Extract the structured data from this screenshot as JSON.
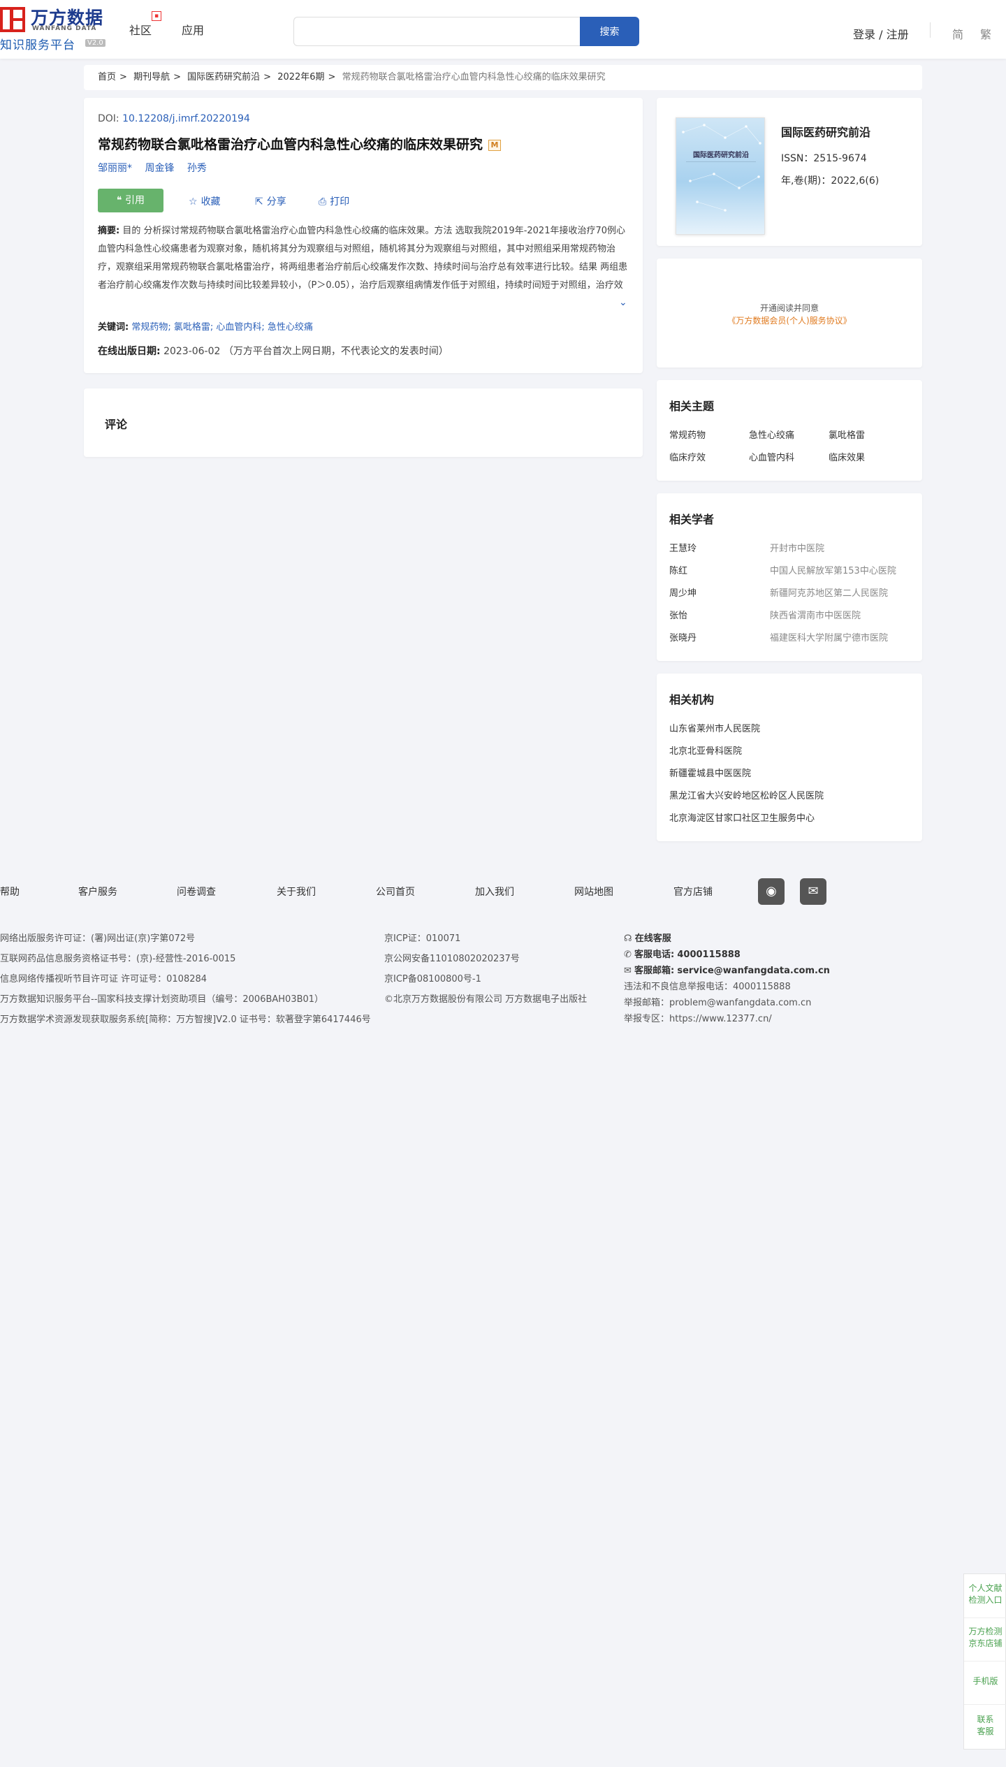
{
  "header": {
    "logo_cn": "万方数据",
    "logo_en": "WANFANG DATA",
    "platform": "知识服务平台",
    "version": "V2.0",
    "nav": [
      "社区",
      "应用"
    ],
    "search_placeholder": "",
    "search_button": "搜索",
    "login": "登录 / 注册",
    "lang_simplified": "简",
    "lang_traditional": "繁"
  },
  "breadcrumb": {
    "items": [
      "首页",
      "期刊导航",
      "国际医药研究前沿",
      "2022年6期"
    ],
    "current": "常规药物联合氯吡格雷治疗心血管内科急性心绞痛的临床效果研究"
  },
  "article": {
    "doi_label": "DOI:",
    "doi": "10.12208/j.imrf.20220194",
    "title": "常规药物联合氯吡格雷治疗心血管内科急性心绞痛的临床效果研究",
    "m_badge": "M",
    "authors": [
      "邹丽丽*",
      "周金锋",
      "孙秀"
    ],
    "actions": {
      "cite": "引用",
      "favorite": "收藏",
      "share": "分享",
      "print": "打印"
    },
    "abstract_label": "摘要:",
    "abstract": "目的 分析探讨常规药物联合氯吡格雷治疗心血管内科急性心绞痛的临床效果。方法 选取我院2019年-2021年接收治疗70例心血管内科急性心绞痛患者为观察对象，随机将其分为观察组与对照组，随机将其分为观察组与对照组，其中对照组采用常规药物治疗，观察组采用常规药物联合氯吡格雷治疗，将两组患者治疗前后心绞痛发作次数、持续时间与治疗总有效率进行比较。结果 两组患者治疗前心绞痛发作次数与持续时间比较差异较小，（P＞0.05），治疗后观察组病情发作低于对照组，持续时间短于对照组，治疗效果比对照组高，两组数据对比较大（P<0.05）。结论 采用常规药物联合氯吡格雷治...",
    "keywords_label": "关键词:",
    "keywords": [
      "常规药物",
      "氯吡格雷",
      "心血管内科",
      "急性心绞痛"
    ],
    "pubdate_label": "在线出版日期:",
    "pubdate": "2023-06-02",
    "pubdate_note": "（万方平台首次上网日期，不代表论文的发表时间）"
  },
  "comments": {
    "title": "评论"
  },
  "journal": {
    "cover_title": "国际医药研究前沿",
    "name": "国际医药研究前沿",
    "issn": "ISSN：2515-9674",
    "volume": "年,卷(期)：2022,6(6)"
  },
  "agreement": {
    "line1": "开通阅读并同意",
    "line2": "《万方数据会员(个人)服务协议》"
  },
  "topics": {
    "title": "相关主题",
    "items": [
      "常规药物",
      "急性心绞痛",
      "氯吡格雷",
      "临床疗效",
      "心血管内科",
      "临床效果"
    ]
  },
  "scholars": {
    "title": "相关学者",
    "items": [
      {
        "name": "王慧玲",
        "org": "开封市中医院"
      },
      {
        "name": "陈红",
        "org": "中国人民解放军第153中心医院"
      },
      {
        "name": "周少坤",
        "org": "新疆阿克苏地区第二人民医院"
      },
      {
        "name": "张怡",
        "org": "陕西省渭南市中医医院"
      },
      {
        "name": "张晓丹",
        "org": "福建医科大学附属宁德市医院"
      }
    ]
  },
  "orgs": {
    "title": "相关机构",
    "items": [
      "山东省莱州市人民医院",
      "北京北亚骨科医院",
      "新疆霍城县中医医院",
      "黑龙江省大兴安岭地区松岭区人民医院",
      "北京海淀区甘家口社区卫生服务中心"
    ]
  },
  "footer": {
    "nav": [
      "帮助",
      "客户服务",
      "问卷调查",
      "关于我们",
      "公司首页",
      "加入我们",
      "网站地图",
      "官方店铺"
    ],
    "col1": [
      "网络出版服务许可证：(署)网出证(京)字第072号",
      "互联网药品信息服务资格证书号：(京)-经营性-2016-0015",
      "信息网络传播视听节目许可证 许可证号：0108284",
      "万方数据知识服务平台--国家科技支撑计划资助项目（编号：2006BAH03B01）",
      "万方数据学术资源发现获取服务系统[简称：万方智搜]V2.0 证书号：软著登字第6417446号"
    ],
    "col2": [
      "京ICP证：010071",
      "京公网安备11010802020237号",
      "京ICP备08100800号-1",
      "©北京万方数据股份有限公司 万方数据电子出版社"
    ],
    "online_service": "在线客服",
    "phone_label": "客服电话:",
    "phone": "4000115888",
    "email_label": "客服邮箱:",
    "email": "service@wanfangdata.com.cn",
    "report_phone": "违法和不良信息举报电话：4000115888",
    "report_email": "举报邮箱：problem@wanfangdata.com.cn",
    "report_site": "举报专区：https://www.12377.cn/"
  },
  "sidefloat": {
    "items": [
      "个人文献\n检测入口",
      "万方检测\n京东店铺",
      "手机版",
      "联系\n客服"
    ]
  }
}
